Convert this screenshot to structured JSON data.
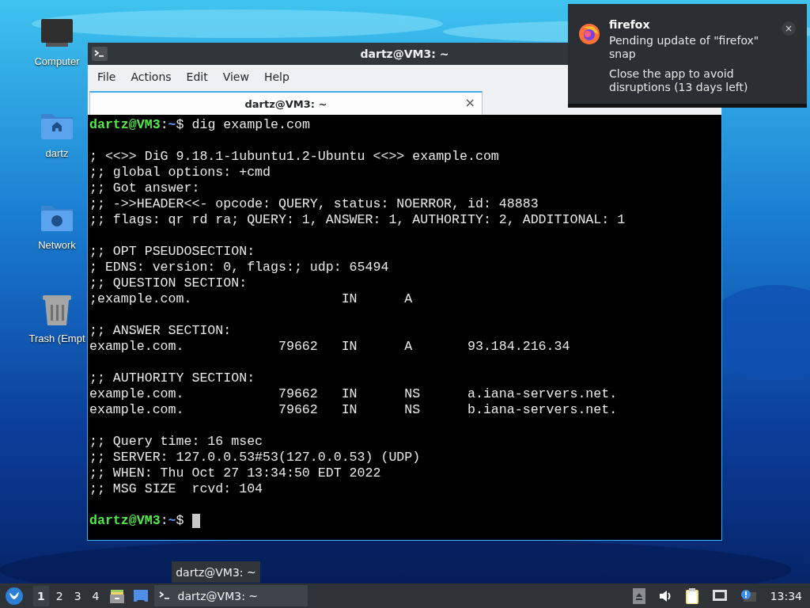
{
  "desktop_icons": [
    {
      "label": "Computer",
      "kind": "computer"
    },
    {
      "label": "dartz",
      "kind": "home"
    },
    {
      "label": "Network",
      "kind": "network"
    },
    {
      "label": "Trash (Empt",
      "kind": "trash"
    }
  ],
  "window": {
    "title": "dartz@VM3: ~",
    "menu": [
      "File",
      "Actions",
      "Edit",
      "View",
      "Help"
    ],
    "tabs": [
      {
        "label": "dartz@VM3: ~",
        "close": "×",
        "selected": true
      }
    ],
    "terminal": {
      "lines": [
        {
          "kind": "prompt",
          "user": "dartz@VM3",
          "sep": ":",
          "path": "~",
          "symbol": "$",
          "command": "dig example.com"
        },
        {
          "kind": "blank"
        },
        {
          "kind": "output",
          "text": "; <<>> DiG 9.18.1-1ubuntu1.2-Ubuntu <<>> example.com"
        },
        {
          "kind": "output",
          "text": ";; global options: +cmd"
        },
        {
          "kind": "output",
          "text": ";; Got answer:"
        },
        {
          "kind": "output",
          "text": ";; ->>HEADER<<- opcode: QUERY, status: NOERROR, id: 48883"
        },
        {
          "kind": "output",
          "text": ";; flags: qr rd ra; QUERY: 1, ANSWER: 1, AUTHORITY: 2, ADDITIONAL: 1"
        },
        {
          "kind": "blank"
        },
        {
          "kind": "output",
          "text": ";; OPT PSEUDOSECTION:"
        },
        {
          "kind": "output",
          "text": "; EDNS: version: 0, flags:; udp: 65494"
        },
        {
          "kind": "output",
          "text": ";; QUESTION SECTION:"
        },
        {
          "kind": "output",
          "text": ";example.com.                   IN      A"
        },
        {
          "kind": "blank"
        },
        {
          "kind": "output",
          "text": ";; ANSWER SECTION:"
        },
        {
          "kind": "output",
          "text": "example.com.            79662   IN      A       93.184.216.34"
        },
        {
          "kind": "blank"
        },
        {
          "kind": "output",
          "text": ";; AUTHORITY SECTION:"
        },
        {
          "kind": "output",
          "text": "example.com.            79662   IN      NS      a.iana-servers.net."
        },
        {
          "kind": "output",
          "text": "example.com.            79662   IN      NS      b.iana-servers.net."
        },
        {
          "kind": "blank"
        },
        {
          "kind": "output",
          "text": ";; Query time: 16 msec"
        },
        {
          "kind": "output",
          "text": ";; SERVER: 127.0.0.53#53(127.0.0.53) (UDP)"
        },
        {
          "kind": "output",
          "text": ";; WHEN: Thu Oct 27 13:34:50 EDT 2022"
        },
        {
          "kind": "output",
          "text": ";; MSG SIZE  rcvd: 104"
        },
        {
          "kind": "blank"
        },
        {
          "kind": "prompt",
          "user": "dartz@VM3",
          "sep": ":",
          "path": "~",
          "symbol": "$",
          "cursor": true
        }
      ]
    }
  },
  "notification": {
    "app": "firefox",
    "close": "×",
    "body": "Pending update of \"firefox\" snap",
    "detail": "Close the app to avoid disruptions (13 days left)"
  },
  "tooltip": "dartz@VM3: ~",
  "taskbar": {
    "workspaces": [
      {
        "label": "1",
        "selected": true
      },
      {
        "label": "2",
        "selected": false
      },
      {
        "label": "3",
        "selected": false
      },
      {
        "label": "4",
        "selected": false
      }
    ],
    "tasks": [
      {
        "label": "dartz@VM3: ~",
        "selected": false
      }
    ],
    "clock": "13:34"
  }
}
